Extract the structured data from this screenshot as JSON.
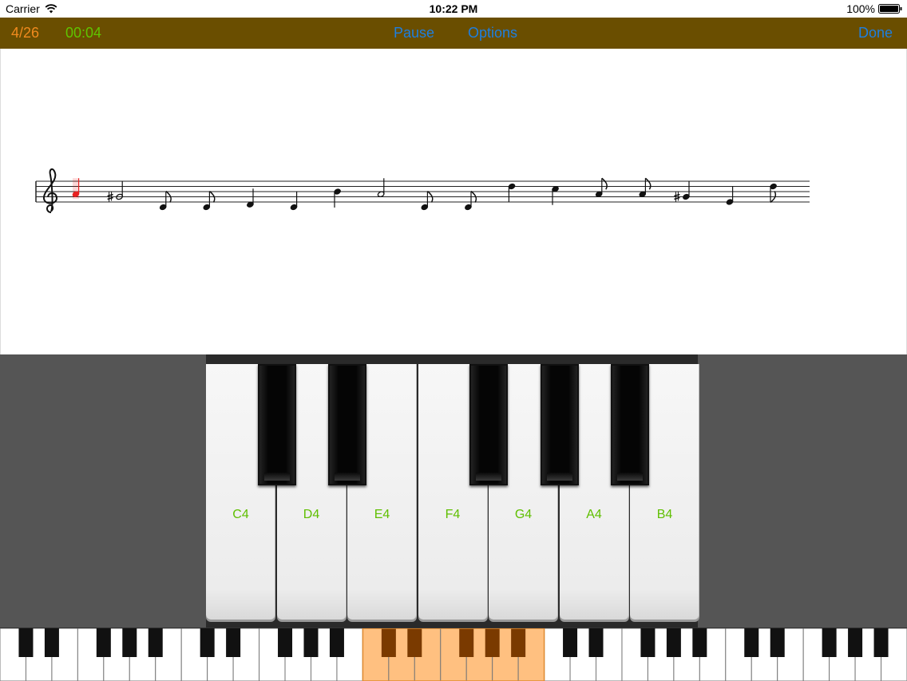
{
  "status_bar": {
    "carrier": "Carrier",
    "time": "10:22 PM",
    "battery": "100%"
  },
  "toolbar": {
    "progress": "4/26",
    "timer": "00:04",
    "pause_label": "Pause",
    "options_label": "Options",
    "done_label": "Done",
    "colors": {
      "bar": "#6a4e00",
      "progress": "#f08a1e",
      "timer": "#5fc400",
      "buttons": "#1e7fe0"
    }
  },
  "staff": {
    "clef": "treble-clef",
    "current_note_color": "#e82020",
    "notes": [
      {
        "type": "quarter",
        "step": 3,
        "accidental": "",
        "current": true
      },
      {
        "type": "half",
        "step": 2,
        "accidental": "sharp",
        "current": false
      },
      {
        "type": "eighth",
        "step": -2,
        "accidental": "",
        "current": false
      },
      {
        "type": "eighth",
        "step": -2,
        "accidental": "",
        "current": false
      },
      {
        "type": "quarter",
        "step": -1,
        "accidental": "",
        "current": false
      },
      {
        "type": "quarter",
        "step": -2,
        "accidental": "",
        "current": false
      },
      {
        "type": "quarter",
        "step": 4,
        "accidental": "",
        "current": false
      },
      {
        "type": "half",
        "step": 3,
        "accidental": "",
        "current": false
      },
      {
        "type": "eighth",
        "step": -2,
        "accidental": "",
        "current": false
      },
      {
        "type": "eighth",
        "step": -2,
        "accidental": "",
        "current": false
      },
      {
        "type": "quarter",
        "step": 6,
        "accidental": "",
        "current": false
      },
      {
        "type": "quarter",
        "step": 5,
        "accidental": "",
        "current": false
      },
      {
        "type": "eighth",
        "step": 3,
        "accidental": "",
        "current": false
      },
      {
        "type": "eighth",
        "step": 3,
        "accidental": "",
        "current": false
      },
      {
        "type": "quarter",
        "step": 2,
        "accidental": "sharp",
        "current": false
      },
      {
        "type": "quarter",
        "step": 0,
        "accidental": "",
        "current": false
      },
      {
        "type": "eighth",
        "step": 6,
        "accidental": "",
        "current": false
      }
    ]
  },
  "keyboard": {
    "white_keys": [
      {
        "label": "C4"
      },
      {
        "label": "D4"
      },
      {
        "label": "E4"
      },
      {
        "label": "F4"
      },
      {
        "label": "G4"
      },
      {
        "label": "A4"
      },
      {
        "label": "B4"
      }
    ],
    "label_color": "#5fbf00"
  },
  "mini_keyboard": {
    "highlight_color": "#ffc080"
  }
}
